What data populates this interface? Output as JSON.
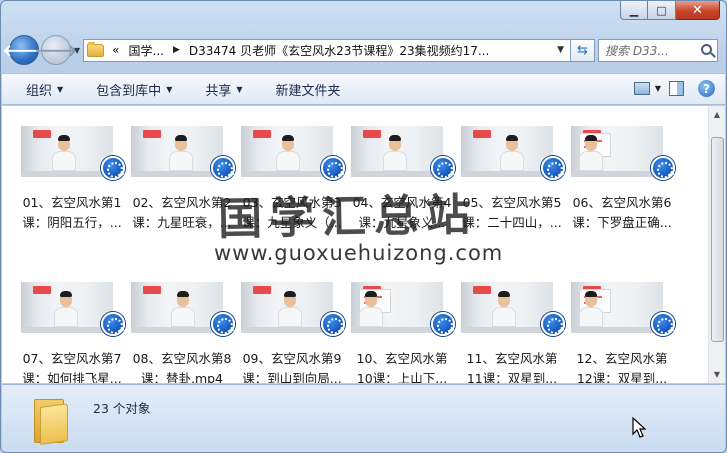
{
  "window": {
    "minimize_glyph": "▁",
    "maximize_glyph": "□",
    "close_glyph": "✕"
  },
  "address": {
    "overflow": "«",
    "crumbs": [
      "国学...",
      "D33474 贝老师《玄空风水23节课程》23集视频约17..."
    ]
  },
  "search": {
    "placeholder": "搜索 D33..."
  },
  "toolbar": {
    "organize": "组织",
    "include_in_library": "包含到库中",
    "share": "共享",
    "new_folder": "新建文件夹"
  },
  "files": [
    {
      "line1": "01、玄空风水第1",
      "line2": "课：阴阳五行，..."
    },
    {
      "line1": "02、玄空风水第2",
      "line2": "课：九星旺衰，..."
    },
    {
      "line1": "03、玄空风水第3",
      "line2": "课：九星象义（..."
    },
    {
      "line1": "04、玄空风水第4",
      "line2": "课：九星象义..."
    },
    {
      "line1": "05、玄空风水第5",
      "line2": "课：二十四山，..."
    },
    {
      "line1": "06、玄空风水第6",
      "line2": "课：下罗盘正确..."
    },
    {
      "line1": "07、玄空风水第7",
      "line2": "课：如何排飞星..."
    },
    {
      "line1": "08、玄空风水第8",
      "line2": "课：替卦.mp4"
    },
    {
      "line1": "09、玄空风水第9",
      "line2": "课：到山到向局..."
    },
    {
      "line1": "10、玄空风水第",
      "line2": "10课：上山下..."
    },
    {
      "line1": "11、玄空风水第",
      "line2": "11课：双星到..."
    },
    {
      "line1": "12、玄空风水第",
      "line2": "12课：双星到..."
    }
  ],
  "watermark": {
    "text": "国学汇总站",
    "url": "www.guoxuehuizong.com"
  },
  "status": {
    "count": "23 个对象"
  }
}
